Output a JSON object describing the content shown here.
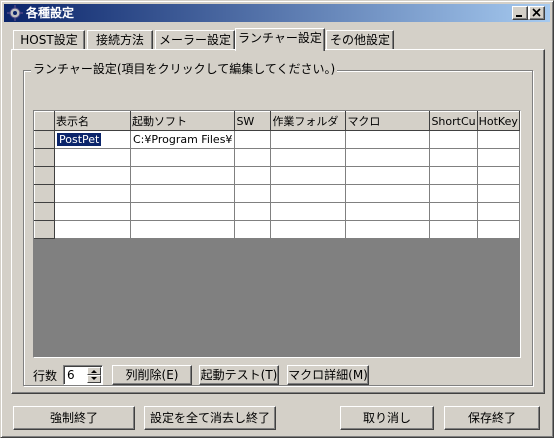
{
  "window": {
    "title": "各種設定",
    "controls": {
      "minimize_icon": "minimize-icon",
      "maximize_icon": "maximize-icon",
      "close_icon": "close-icon"
    }
  },
  "tabs": [
    {
      "label": "HOST設定",
      "active": false
    },
    {
      "label": "接続方法",
      "active": false
    },
    {
      "label": "メーラー設定",
      "active": false
    },
    {
      "label": "ランチャー設定",
      "active": true
    },
    {
      "label": "その他設定",
      "active": false
    }
  ],
  "launcher": {
    "group_title": "ランチャー設定(項目をクリックして編集してください。)",
    "columns": [
      "表示名",
      "起動ソフト",
      "SW",
      "作業フォルダ",
      "マクロ",
      "ShortCu",
      "HotKey"
    ],
    "rows": [
      [
        "PostPet",
        "C:¥Program Files¥",
        "",
        "",
        "",
        "",
        ""
      ],
      [
        "",
        "",
        "",
        "",
        "",
        "",
        ""
      ],
      [
        "",
        "",
        "",
        "",
        "",
        "",
        ""
      ],
      [
        "",
        "",
        "",
        "",
        "",
        "",
        ""
      ],
      [
        "",
        "",
        "",
        "",
        "",
        "",
        ""
      ],
      [
        "",
        "",
        "",
        "",
        "",
        "",
        ""
      ]
    ],
    "row_count_label": "行数",
    "row_count_value": "6",
    "buttons": {
      "delete_row": "列削除(E)",
      "test_launch": "起動テスト(T)",
      "macro_detail": "マクロ詳細(M)"
    }
  },
  "footer": {
    "force_quit": "強制終了",
    "clear_all_quit": "設定を全て消去し終了",
    "cancel": "取り消し",
    "save_quit": "保存終了"
  },
  "colors": {
    "face": "#d4d0c8",
    "title_start": "#0a246a",
    "title_end": "#a6caf0",
    "selection": "#0a246a"
  }
}
